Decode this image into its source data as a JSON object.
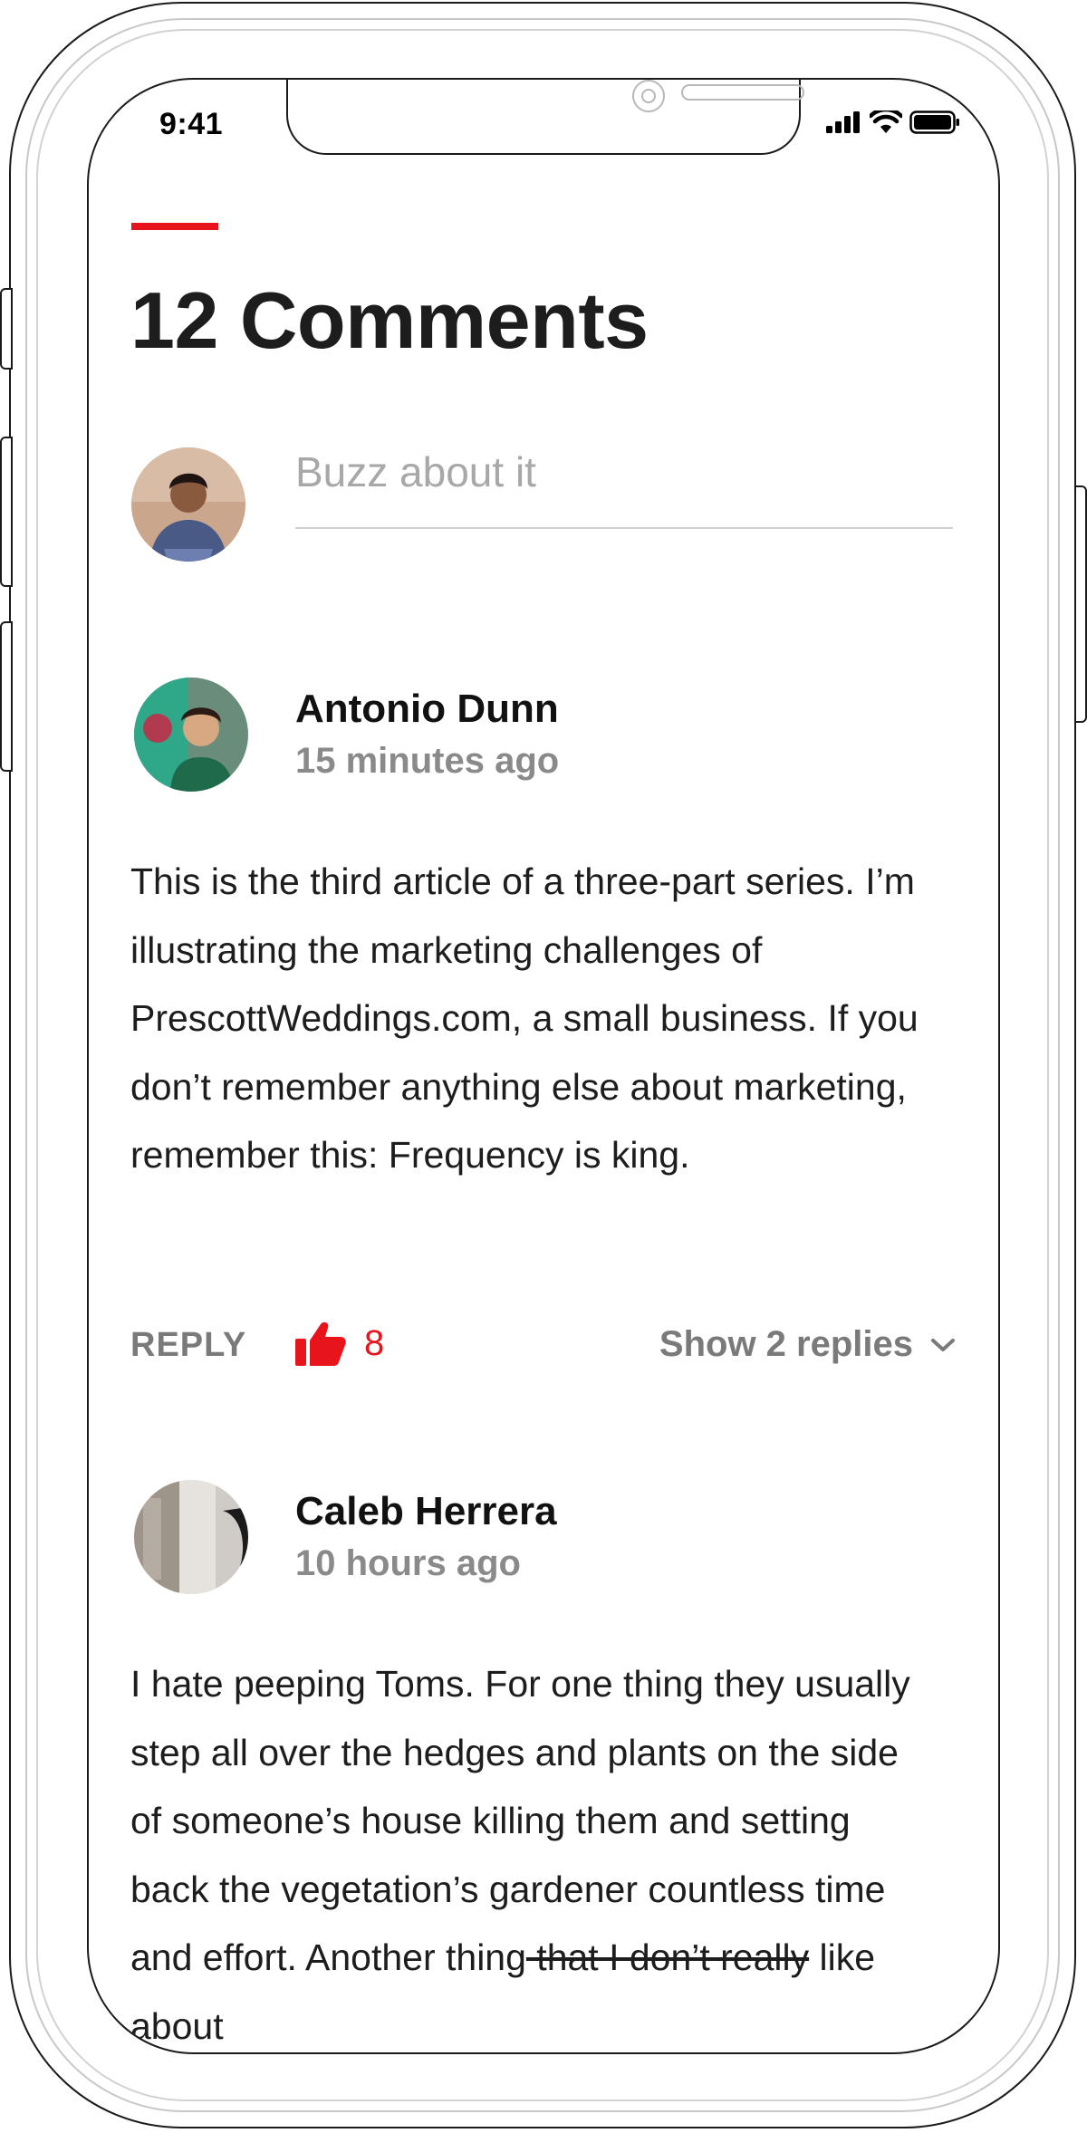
{
  "status_bar": {
    "time": "9:41"
  },
  "header": {
    "title": "12 Comments"
  },
  "composer": {
    "placeholder": "Buzz about it"
  },
  "comments": [
    {
      "author": "Antonio Dunn",
      "time": "15 minutes ago",
      "body": "This is the third article of a three-part series. I’m illustrating the marketing challenges of PrescottWeddings.com, a small business. If you don’t remember anything else about marketing, remember this: Frequency is king.",
      "reply_label": "REPLY",
      "likes": "8",
      "show_replies": "Show 2 replies"
    },
    {
      "author": "Caleb Herrera",
      "time": "10 hours ago",
      "body_before": "I hate peeping Toms. For one thing they usually step all over the hedges and plants on the side of someone’s house killing them and setting back the vegetation’s gardener countless time and effort. Another thing",
      "body_struck": " that I don’t really",
      "body_after": " like about"
    }
  ],
  "colors": {
    "accent": "#e8141c",
    "text": "#1d1d1d",
    "muted": "#8a8a8a"
  },
  "icons": [
    "signal-icon",
    "wifi-icon",
    "battery-icon",
    "thumbs-up-icon",
    "chevron-down-icon"
  ]
}
